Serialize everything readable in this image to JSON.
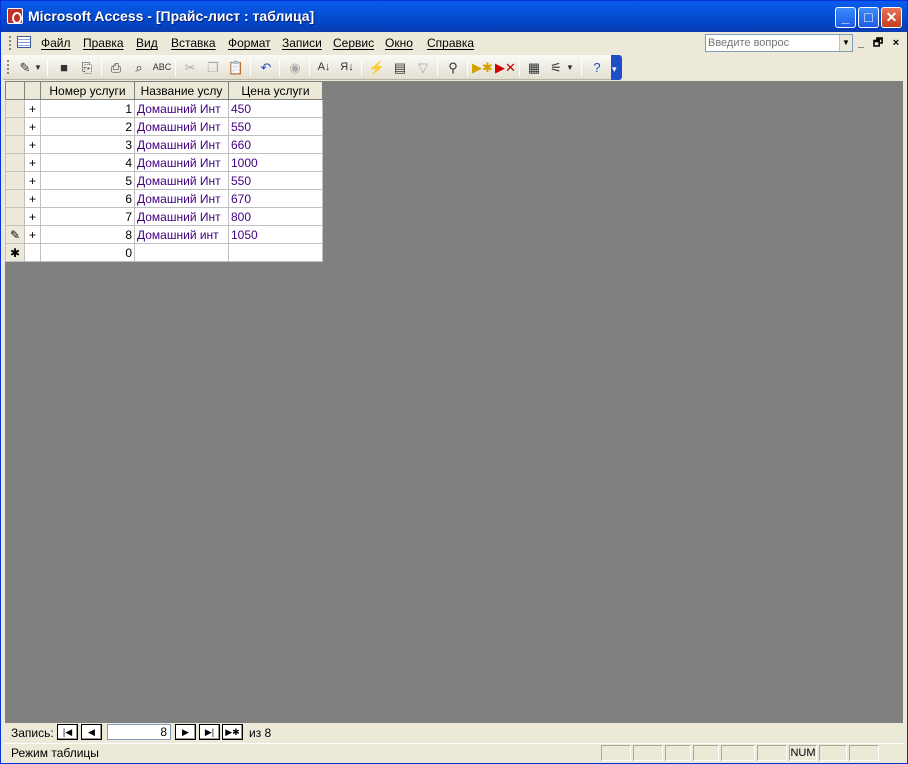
{
  "window": {
    "title": "Microsoft Access - [Прайс-лист : таблица]",
    "buttons": {
      "minimize": "_",
      "maximize": "□",
      "close": "✕"
    }
  },
  "menu": {
    "items": [
      "Файл",
      "Правка",
      "Вид",
      "Вставка",
      "Формат",
      "Записи",
      "Сервис",
      "Окно",
      "Справка"
    ],
    "ask_placeholder": "Введите вопрос",
    "doc_controls": {
      "minimize": "_",
      "restore": "🗗",
      "close": "×"
    }
  },
  "toolbar": {
    "icons": [
      "view-icon",
      "save-icon",
      "search-file-icon",
      "print-icon",
      "print-preview-icon",
      "spelling-icon",
      "cut-icon",
      "copy-icon",
      "paste-icon",
      "undo-icon",
      "hyperlink-icon",
      "sort-asc-icon",
      "sort-desc-icon",
      "filter-by-selection-icon",
      "filter-by-form-icon",
      "apply-filter-icon",
      "find-icon",
      "new-record-icon",
      "delete-record-icon",
      "properties-icon",
      "new-object-icon",
      "help-icon"
    ]
  },
  "table": {
    "columns": [
      "Номер услуги",
      "Название услу",
      "Цена услуги"
    ],
    "rows": [
      {
        "num": "1",
        "name": "Домашний Инт",
        "price": "450",
        "selector": ""
      },
      {
        "num": "2",
        "name": "Домашний Инт",
        "price": "550",
        "selector": ""
      },
      {
        "num": "3",
        "name": "Домашний Инт",
        "price": "660",
        "selector": ""
      },
      {
        "num": "4",
        "name": "Домашний Инт",
        "price": "1000",
        "selector": ""
      },
      {
        "num": "5",
        "name": "Домашний Инт",
        "price": "550",
        "selector": ""
      },
      {
        "num": "6",
        "name": "Домашний Инт",
        "price": "670",
        "selector": ""
      },
      {
        "num": "7",
        "name": "Домашний Инт",
        "price": "800",
        "selector": ""
      },
      {
        "num": "8",
        "name": "Домашний инт",
        "price": "1050",
        "selector": "✎"
      }
    ],
    "new_row": {
      "num": "0",
      "selector": "✱"
    },
    "expand_glyph": "+"
  },
  "navigator": {
    "label": "Запись:",
    "current": "8",
    "of_label": "из 8",
    "buttons": {
      "first": "|◀",
      "prev": "◀",
      "next": "▶",
      "last": "▶|",
      "new": "▶✱"
    }
  },
  "status": {
    "text": "Режим таблицы",
    "num": "NUM"
  }
}
